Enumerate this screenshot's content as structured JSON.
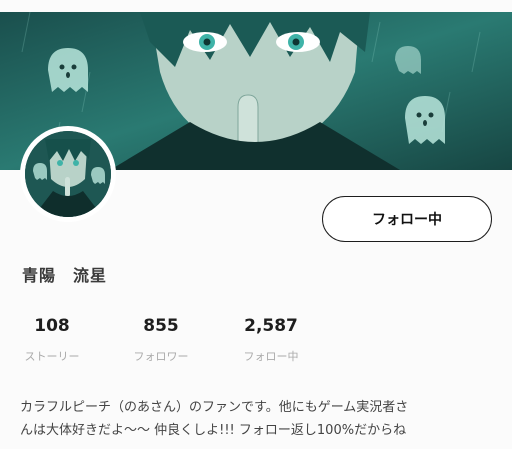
{
  "profile": {
    "name": "青陽　流星",
    "follow_button_label": "フォロー中",
    "bio_line1": "カラフルピーチ（のあさん）のファンです。他にもゲーム実況者さ",
    "bio_line2": "んは大体好きだよ〜〜 仲良くしよ!!! フォロー返し100%だからね"
  },
  "stats": [
    {
      "value": "108",
      "label": "ストーリー"
    },
    {
      "value": "855",
      "label": "フォロワー"
    },
    {
      "value": "2,587",
      "label": "フォロー中"
    }
  ],
  "colors": {
    "cover_teal": "#1f6b66",
    "button_border": "#1d1d1d",
    "muted_label": "#aaaaaa"
  }
}
